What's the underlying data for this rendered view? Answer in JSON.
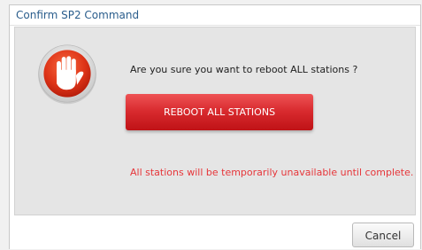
{
  "dialog": {
    "title": "Confirm SP2 Command",
    "question": "Are you sure you want to reboot ALL stations ?",
    "reboot_label": "REBOOT ALL STATIONS",
    "warning": "All stations will be temporarily unavailable until complete.",
    "cancel_label": "Cancel",
    "icon": "stop-hand-icon"
  },
  "colors": {
    "title_text": "#2a5d8c",
    "danger_button": "#d82a2e",
    "warning_text": "#e6363a",
    "content_background": "#e5e5e5"
  }
}
